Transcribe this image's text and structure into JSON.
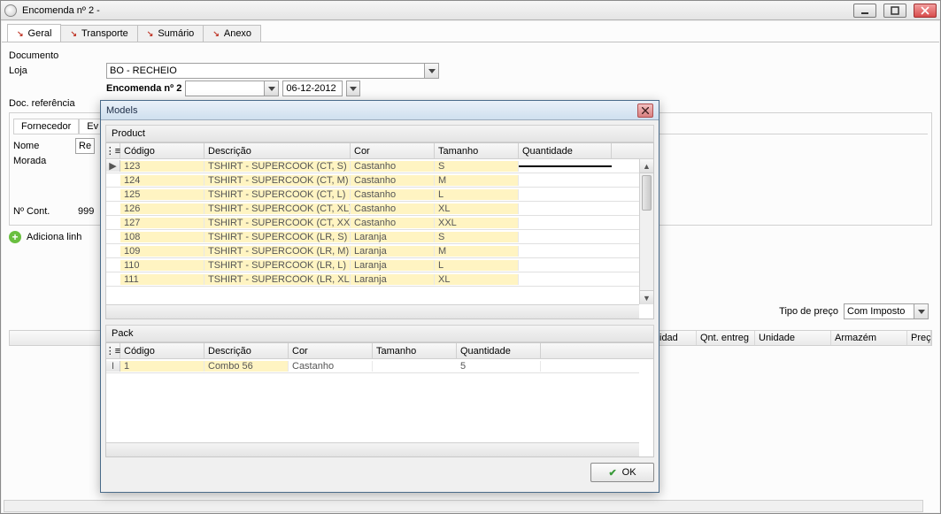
{
  "window": {
    "title": "Encomenda nº 2 -"
  },
  "tabs": [
    "Geral",
    "Transporte",
    "Sumário",
    "Anexo"
  ],
  "active_tab": 0,
  "labels": {
    "documento": "Documento",
    "loja": "Loja",
    "doc_ref": "Doc. referência",
    "nome": "Nome",
    "morada": "Morada",
    "ncont": "Nº Cont.",
    "adiciona": "Adiciona linh",
    "tipo_preco": "Tipo de preço"
  },
  "values": {
    "loja": "BO - RECHEIO",
    "encomenda_label": "Encomenda nº 2",
    "date": "06-12-2012",
    "nome_partial": "Re",
    "ncont_partial": "999",
    "tipo_preco": "Com Imposto"
  },
  "fbox_tabs": [
    "Fornecedor",
    "Ev"
  ],
  "grid_cols": [
    "idad",
    "Qnt. entreg",
    "Unidade",
    "Armazém",
    "Preço"
  ],
  "modal": {
    "title": "Models",
    "section_product": "Product",
    "section_pack": "Pack",
    "ok": "OK",
    "product_headers": [
      "Código",
      "Descrição",
      "Cor",
      "Tamanho",
      "Quantidade"
    ],
    "product_rows": [
      {
        "codigo": "123",
        "desc": "TSHIRT - SUPERCOOK (CT, S)",
        "cor": "Castanho",
        "tam": "S"
      },
      {
        "codigo": "124",
        "desc": "TSHIRT - SUPERCOOK (CT, M)",
        "cor": "Castanho",
        "tam": "M"
      },
      {
        "codigo": "125",
        "desc": "TSHIRT - SUPERCOOK (CT, L)",
        "cor": "Castanho",
        "tam": "L"
      },
      {
        "codigo": "126",
        "desc": "TSHIRT - SUPERCOOK (CT, XL)",
        "cor": "Castanho",
        "tam": "XL"
      },
      {
        "codigo": "127",
        "desc": "TSHIRT - SUPERCOOK (CT, XXL)",
        "cor": "Castanho",
        "tam": "XXL"
      },
      {
        "codigo": "108",
        "desc": "TSHIRT - SUPERCOOK (LR, S)",
        "cor": "Laranja",
        "tam": "S"
      },
      {
        "codigo": "109",
        "desc": "TSHIRT - SUPERCOOK (LR, M)",
        "cor": "Laranja",
        "tam": "M"
      },
      {
        "codigo": "110",
        "desc": "TSHIRT - SUPERCOOK (LR, L)",
        "cor": "Laranja",
        "tam": "L"
      },
      {
        "codigo": "111",
        "desc": "TSHIRT - SUPERCOOK (LR, XL)",
        "cor": "Laranja",
        "tam": "XL"
      }
    ],
    "pack_headers": [
      "Código",
      "Descrição",
      "Cor",
      "Tamanho",
      "Quantidade"
    ],
    "pack_rows": [
      {
        "codigo": "1",
        "desc": "Combo 56",
        "cor": "Castanho",
        "tam": "",
        "qty": "5"
      }
    ]
  }
}
